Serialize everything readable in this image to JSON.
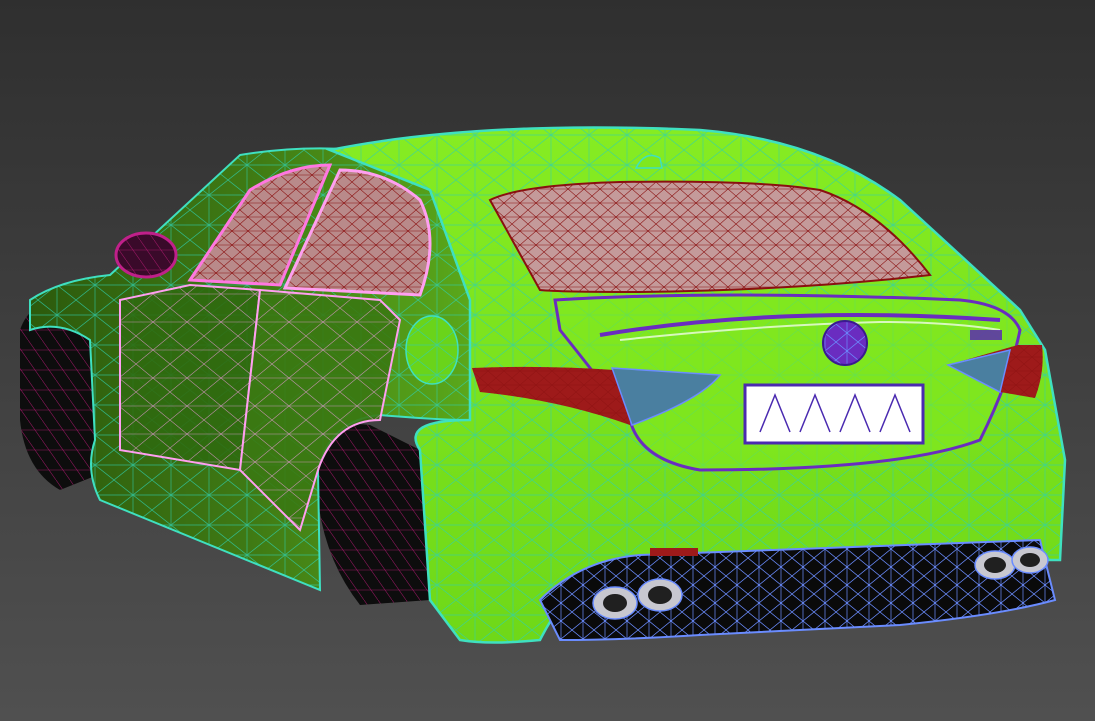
{
  "viewport": {
    "background_top": "#2f2f2f",
    "background_bottom": "#505050"
  },
  "model": {
    "subject": "sedan-rear-three-quarter-wireframe",
    "colors": {
      "body_fill": "#7fe81f",
      "body_fill_dark": "#3f6f12",
      "body_wire": "#2fd0b0",
      "door_wire": "#ff9ff0",
      "glass_fill": "#b98a8a",
      "glass_wire": "#8a1010",
      "mirror_wire": "#b0187a",
      "taillight_fill": "#9e1a1a",
      "tailgate_outline": "#6a2cc0",
      "diffuser_fill": "#0a0a0a",
      "diffuser_wire": "#6a8cff",
      "exhaust_fill": "#c8c8d0",
      "plate_fill": "#ffffff",
      "plate_border": "#4a2ab0",
      "tire_fill": "#101010",
      "tire_wire": "#5a0a3a"
    }
  }
}
